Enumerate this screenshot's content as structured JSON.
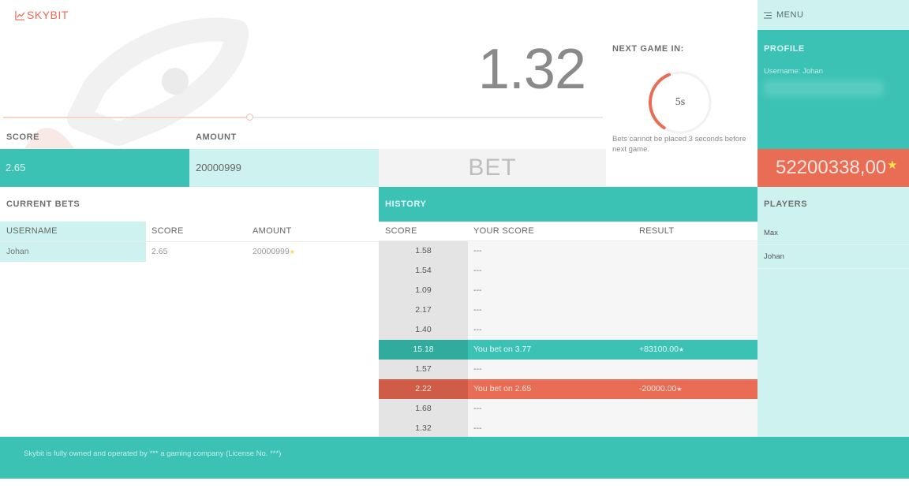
{
  "brand": {
    "logo_text": "SKYBIT",
    "accent": "#e96c55",
    "teal": "#3cc2b4",
    "light_teal": "#cdf2ef"
  },
  "game": {
    "multiplier": "1.32",
    "next_game_label": "NEXT GAME IN:",
    "countdown": "5s",
    "countdown_fraction": 0.35,
    "bet_note": "Bets cannot be placed 3 seconds before next game.",
    "timeline_progress": 0.41
  },
  "bet_form": {
    "score_label": "SCORE",
    "amount_label": "AMOUNT",
    "score_value": "2.65",
    "amount_value": "20000999",
    "bet_button": "BET"
  },
  "menu": {
    "label": "MENU"
  },
  "profile": {
    "label": "PROFILE",
    "username_line": "Username: Johan",
    "balance": "52200338,00",
    "balance_star": "★"
  },
  "players": {
    "label": "PLAYERS",
    "items": [
      {
        "name": "Max"
      },
      {
        "name": "Johan"
      }
    ]
  },
  "current_bets": {
    "label": "CURRENT BETS",
    "columns": [
      "USERNAME",
      "SCORE",
      "AMOUNT"
    ],
    "rows": [
      {
        "username": "Johan",
        "score": "2.65",
        "amount": "20000999"
      }
    ]
  },
  "history": {
    "label": "HISTORY",
    "columns": [
      "SCORE",
      "YOUR SCORE",
      "RESULT"
    ],
    "rows": [
      {
        "score": "1.58",
        "your_score": "---",
        "result": "",
        "status": "none"
      },
      {
        "score": "1.54",
        "your_score": "---",
        "result": "",
        "status": "none"
      },
      {
        "score": "1.09",
        "your_score": "---",
        "result": "",
        "status": "none"
      },
      {
        "score": "2.17",
        "your_score": "---",
        "result": "",
        "status": "none"
      },
      {
        "score": "1.40",
        "your_score": "---",
        "result": "",
        "status": "none"
      },
      {
        "score": "15.18",
        "your_score": "You bet on 3.77",
        "result": "+83100.00",
        "status": "win"
      },
      {
        "score": "1.57",
        "your_score": "---",
        "result": "",
        "status": "none"
      },
      {
        "score": "2.22",
        "your_score": "You bet on 2.65",
        "result": "-20000.00",
        "status": "loss"
      },
      {
        "score": "1.68",
        "your_score": "---",
        "result": "",
        "status": "none"
      },
      {
        "score": "1.32",
        "your_score": "---",
        "result": "",
        "status": "none"
      }
    ]
  },
  "footer": {
    "text": "Skybit is fully owned and operated by *** a gaming company (License No. ***)"
  }
}
